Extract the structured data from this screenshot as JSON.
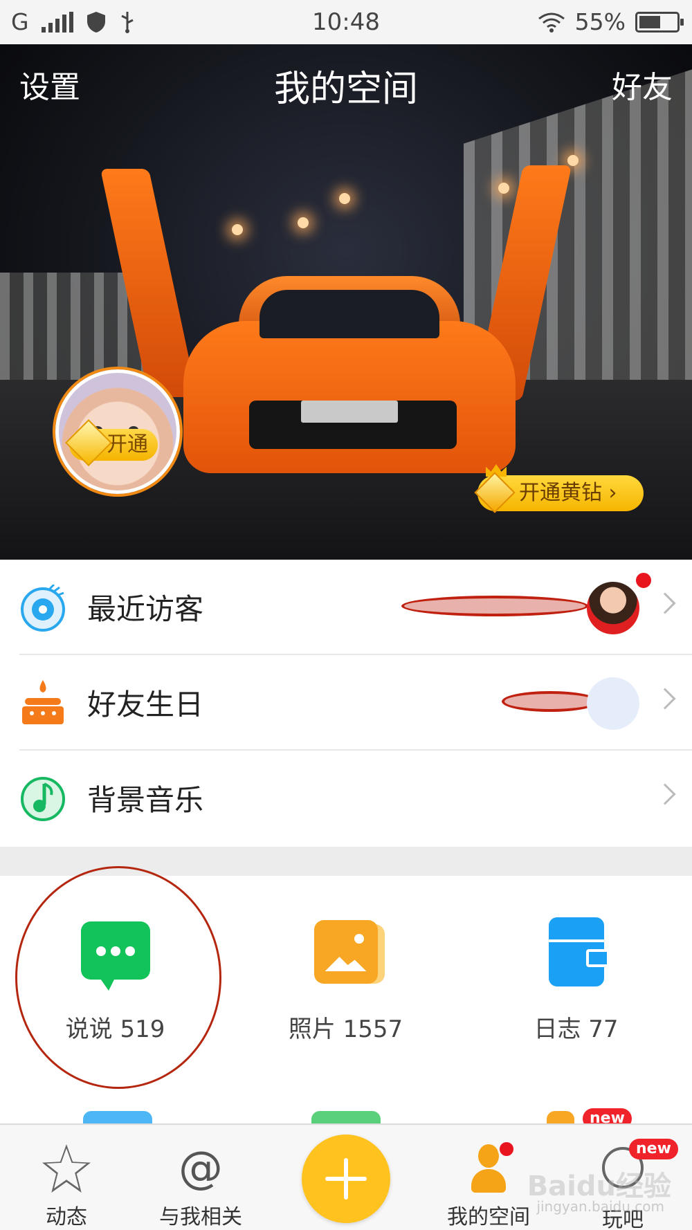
{
  "status_bar": {
    "carrier": "G",
    "time": "10:48",
    "battery": "55%"
  },
  "header": {
    "left": "设置",
    "title": "我的空间",
    "right": "好友"
  },
  "profile": {
    "open_badge": "开通",
    "vip_button": "开通黄钻 ›"
  },
  "menu": [
    {
      "label": "最近访客",
      "icon": "eye-icon"
    },
    {
      "label": "好友生日",
      "icon": "cake-icon"
    },
    {
      "label": "背景音乐",
      "icon": "music-note-icon"
    }
  ],
  "grid": [
    {
      "label": "说说 519",
      "icon": "chat-bubble-icon",
      "color": "#12c35a"
    },
    {
      "label": "照片 1557",
      "icon": "photo-icon",
      "color": "#f8a725"
    },
    {
      "label": "日志 77",
      "icon": "diary-icon",
      "color": "#1aa0f5"
    }
  ],
  "peek_badge": "new",
  "tabs": [
    {
      "label": "动态",
      "icon": "star-icon"
    },
    {
      "label": "与我相关",
      "icon": "at-icon"
    },
    {
      "label": "",
      "icon": "plus-icon"
    },
    {
      "label": "我的空间",
      "icon": "person-icon"
    },
    {
      "label": "玩吧",
      "icon": "game-icon",
      "badge": "new"
    }
  ],
  "watermark": {
    "logo": "Baidu经验",
    "url": "jingyan.baidu.com"
  },
  "colors": {
    "accent": "#ffc21e",
    "vip": "#f6b500",
    "annotation": "#b5260f"
  }
}
